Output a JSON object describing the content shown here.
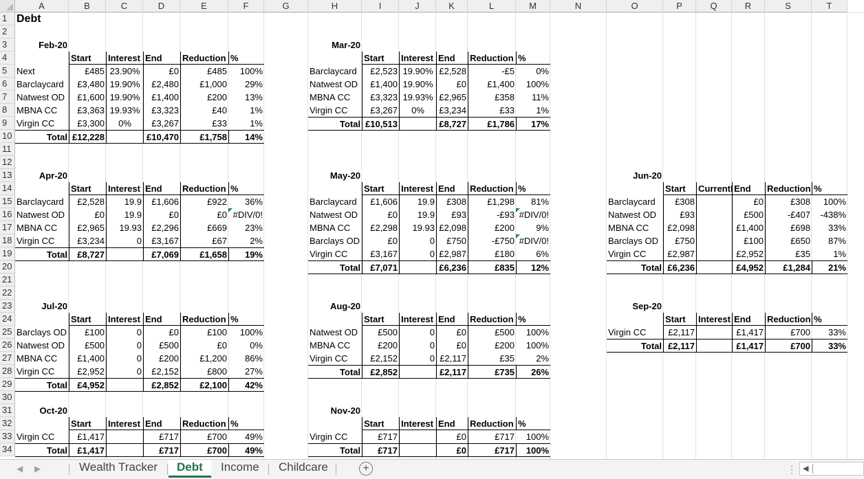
{
  "columns": [
    "A",
    "B",
    "C",
    "D",
    "E",
    "F",
    "G",
    "H",
    "I",
    "J",
    "K",
    "L",
    "M",
    "N",
    "O",
    "P",
    "Q",
    "R",
    "S",
    "T"
  ],
  "rows": [
    "1",
    "2",
    "3",
    "4",
    "5",
    "6",
    "7",
    "8",
    "9",
    "10",
    "11",
    "12",
    "13",
    "14",
    "15",
    "16",
    "17",
    "18",
    "19",
    "20",
    "21",
    "22",
    "23",
    "24",
    "25",
    "26",
    "27",
    "28",
    "29",
    "30",
    "31",
    "32",
    "33",
    "34"
  ],
  "sheet_title": "Debt",
  "headers": {
    "start": "Start",
    "interest": "Interest",
    "end": "End",
    "reduction": "Reduction",
    "pct": "%",
    "current": "CurrentI"
  },
  "total_label": "Total",
  "blocks": {
    "feb": {
      "month": "Feb-20",
      "rows": [
        [
          "Next",
          "£485",
          "23.90%",
          "£0",
          "£485",
          "100%"
        ],
        [
          "Barclaycard",
          "£3,480",
          "19.90%",
          "£2,480",
          "£1,000",
          "29%"
        ],
        [
          "Natwest OD",
          "£1,600",
          "19.90%",
          "£1,400",
          "£200",
          "13%"
        ],
        [
          "MBNA CC",
          "£3,363",
          "19.93%",
          "£3,323",
          "£40",
          "1%"
        ],
        [
          "Virgin CC",
          "£3,300",
          "0%",
          "£3,267",
          "£33",
          "1%"
        ]
      ],
      "total": [
        "£12,228",
        "£10,470",
        "£1,758",
        "14%"
      ]
    },
    "mar": {
      "month": "Mar-20",
      "rows": [
        [
          "Barclaycard",
          "£2,523",
          "19.90%",
          "£2,528",
          "-£5",
          "0%"
        ],
        [
          "Natwest OD",
          "£1,400",
          "19.90%",
          "£0",
          "£1,400",
          "100%"
        ],
        [
          "MBNA CC",
          "£3,323",
          "19.93%",
          "£2,965",
          "£358",
          "11%"
        ],
        [
          "Virgin CC",
          "£3,267",
          "0%",
          "£3,234",
          "£33",
          "1%"
        ]
      ],
      "total": [
        "£10,513",
        "£8,727",
        "£1,786",
        "17%"
      ]
    },
    "apr": {
      "month": "Apr-20",
      "rows": [
        [
          "Barclaycard",
          "£2,528",
          "19.9",
          "£1,606",
          "£922",
          "36%"
        ],
        [
          "Natwest OD",
          "£0",
          "19.9",
          "£0",
          "£0",
          "#DIV/0!"
        ],
        [
          "MBNA CC",
          "£2,965",
          "19.93",
          "£2,296",
          "£669",
          "23%"
        ],
        [
          "Virgin CC",
          "£3,234",
          "0",
          "£3,167",
          "£67",
          "2%"
        ]
      ],
      "total": [
        "£8,727",
        "£7,069",
        "£1,658",
        "19%"
      ]
    },
    "may": {
      "month": "May-20",
      "rows": [
        [
          "Barclaycard",
          "£1,606",
          "19.9",
          "£308",
          "£1,298",
          "81%"
        ],
        [
          "Natwest OD",
          "£0",
          "19.9",
          "£93",
          "-£93",
          "#DIV/0!"
        ],
        [
          "MBNA CC",
          "£2,298",
          "19.93",
          "£2,098",
          "£200",
          "9%"
        ],
        [
          "Barclays OD",
          "£0",
          "0",
          "£750",
          "-£750",
          "#DIV/0!"
        ],
        [
          "Virgin CC",
          "£3,167",
          "0",
          "£2,987",
          "£180",
          "6%"
        ]
      ],
      "total": [
        "£7,071",
        "£6,236",
        "£835",
        "12%"
      ]
    },
    "jun": {
      "month": "Jun-20",
      "rows": [
        [
          "Barclaycard",
          "£308",
          "",
          "£0",
          "£308",
          "100%"
        ],
        [
          "Natwest OD",
          "£93",
          "",
          "£500",
          "-£407",
          "-438%"
        ],
        [
          "MBNA CC",
          "£2,098",
          "",
          "£1,400",
          "£698",
          "33%"
        ],
        [
          "Barclays OD",
          "£750",
          "",
          "£100",
          "£650",
          "87%"
        ],
        [
          "Virgin CC",
          "£2,987",
          "",
          "£2,952",
          "£35",
          "1%"
        ]
      ],
      "total": [
        "£6,236",
        "£4,952",
        "£1,284",
        "21%"
      ]
    },
    "jul": {
      "month": "Jul-20",
      "rows": [
        [
          "Barclays OD",
          "£100",
          "0",
          "£0",
          "£100",
          "100%"
        ],
        [
          "Natwest OD",
          "£500",
          "0",
          "£500",
          "£0",
          "0%"
        ],
        [
          "MBNA CC",
          "£1,400",
          "0",
          "£200",
          "£1,200",
          "86%"
        ],
        [
          "Virgin CC",
          "£2,952",
          "0",
          "£2,152",
          "£800",
          "27%"
        ]
      ],
      "total": [
        "£4,952",
        "£2,852",
        "£2,100",
        "42%"
      ]
    },
    "aug": {
      "month": "Aug-20",
      "rows": [
        [
          "Natwest OD",
          "£500",
          "0",
          "£0",
          "£500",
          "100%"
        ],
        [
          "MBNA CC",
          "£200",
          "0",
          "£0",
          "£200",
          "100%"
        ],
        [
          "Virgin CC",
          "£2,152",
          "0",
          "£2,117",
          "£35",
          "2%"
        ]
      ],
      "total": [
        "£2,852",
        "£2,117",
        "£735",
        "26%"
      ]
    },
    "sep": {
      "month": "Sep-20",
      "rows": [
        [
          "Virgin CC",
          "£2,117",
          "",
          "£1,417",
          "£700",
          "33%"
        ]
      ],
      "total": [
        "£2,117",
        "£1,417",
        "£700",
        "33%"
      ]
    },
    "oct": {
      "month": "Oct-20",
      "rows": [
        [
          "Virgin CC",
          "£1,417",
          "",
          "£717",
          "£700",
          "49%"
        ]
      ],
      "total": [
        "£1,417",
        "£717",
        "£700",
        "49%"
      ]
    },
    "nov": {
      "month": "Nov-20",
      "rows": [
        [
          "Virgin CC",
          "£717",
          "",
          "£0",
          "£717",
          "100%"
        ]
      ],
      "total": [
        "£717",
        "£0",
        "£717",
        "100%"
      ]
    }
  },
  "tabs": [
    "Wealth Tracker",
    "Debt",
    "Income",
    "Childcare"
  ],
  "active_tab": "Debt",
  "nav": {
    "prev": "◀",
    "next": "▶",
    "add": "+",
    "more": "⋮",
    "scroll_left": "◀"
  },
  "colors": {
    "accent": "#217346",
    "flag": "#1e8b3a"
  }
}
